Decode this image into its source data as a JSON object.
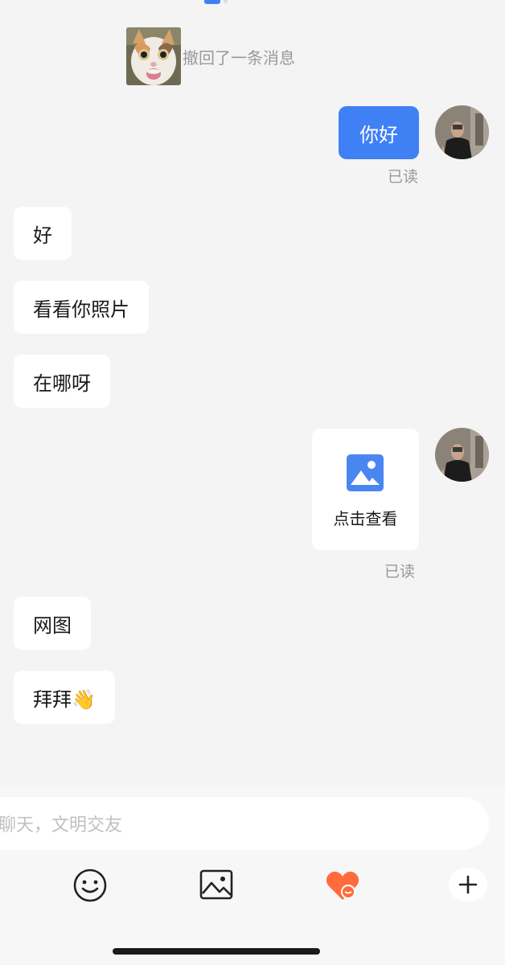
{
  "recall": {
    "text": "撤回了一条消息"
  },
  "messages": {
    "hello": {
      "text": "你好",
      "status": "已读"
    },
    "m1": "好",
    "m2": "看看你照片",
    "m3": "在哪呀",
    "image_card": {
      "label": "点击查看",
      "status": "已读"
    },
    "m4": "网图",
    "m5": "拜拜👋"
  },
  "input": {
    "placeholder": "聊天，文明交友"
  },
  "toolbar": {
    "icons": [
      "emoji-icon",
      "image-icon",
      "heart-icon",
      "plus-icon"
    ]
  },
  "colors": {
    "accent": "#4080f5",
    "heart": "#ff6b3d",
    "background": "#f4f4f4"
  }
}
